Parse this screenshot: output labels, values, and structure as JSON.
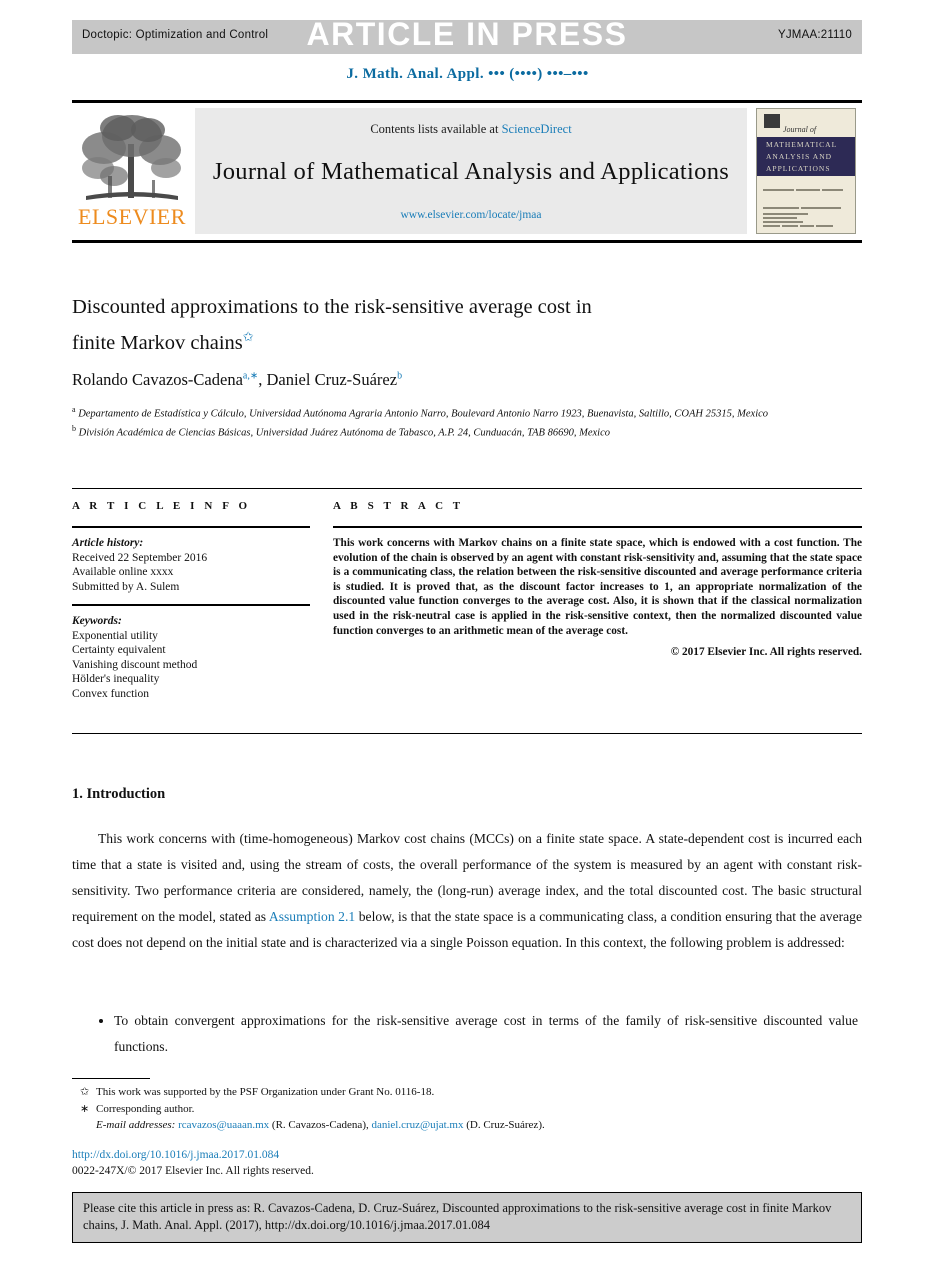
{
  "header": {
    "doctopic": "Doctopic: Optimization and Control",
    "article_in_press": "ARTICLE IN PRESS",
    "pii": "YJMAA:21110",
    "running_head": "J. Math. Anal. Appl. ••• (••••) •••–•••"
  },
  "masthead": {
    "contents_prefix": "Contents lists available at ",
    "sciencedirect": "ScienceDirect",
    "journal_name": "Journal of Mathematical Analysis and Applications",
    "journal_url": "www.elsevier.com/locate/jmaa",
    "publisher": "ELSEVIER",
    "cover": {
      "script": "Journal of",
      "line1": "MATHEMATICAL",
      "line2": "ANALYSIS AND",
      "line3": "APPLICATIONS"
    }
  },
  "article": {
    "title_line1": "Discounted approximations to the risk-sensitive average cost in",
    "title_line2": "finite Markov chains",
    "title_mark": "✩",
    "authors": "Rolando Cavazos-Cadena",
    "author1_sup": "a,∗",
    "authors2": ", Daniel Cruz-Suárez",
    "author2_sup": "b",
    "affiliation_a_sup": "a",
    "affiliation_a": "Departamento de Estadística y Cálculo, Universidad Autónoma Agraria Antonio Narro, Boulevard Antonio Narro 1923, Buenavista, Saltillo, COAH 25315, Mexico",
    "affiliation_b_sup": "b",
    "affiliation_b": "División Académica de Ciencias Básicas, Universidad Juárez Autónoma de Tabasco, A.P. 24, Cunduacán, TAB 86690, Mexico"
  },
  "info": {
    "heading": "A R T I C L E   I N F O",
    "history_label": "Article history:",
    "history": [
      "Received 22 September 2016",
      "Available online xxxx",
      "Submitted by A. Sulem"
    ],
    "keywords_label": "Keywords:",
    "keywords": [
      "Exponential utility",
      "Certainty equivalent",
      "Vanishing discount method",
      "Hölder's inequality",
      "Convex function"
    ]
  },
  "abstract": {
    "heading": "A B S T R A C T",
    "text": "This work concerns with Markov chains on a finite state space, which is endowed with a cost function. The evolution of the chain is observed by an agent with constant risk-sensitivity and, assuming that the state space is a communicating class, the relation between the risk-sensitive discounted and average performance criteria is studied. It is proved that, as the discount factor increases to 1, an appropriate normalization of the discounted value function converges to the average cost. Also, it is shown that if the classical normalization used in the risk-neutral case is applied in the risk-sensitive context, then the normalized discounted value function converges to an arithmetic mean of the average cost.",
    "copyright": "© 2017 Elsevier Inc. All rights reserved."
  },
  "body": {
    "section_title": "1. Introduction",
    "paragraph_part1": "This work concerns with (time-homogeneous) Markov cost chains (MCCs) on a finite state space. A state-dependent cost is incurred each time that a state is visited and, using the stream of costs, the overall performance of the system is measured by an agent with constant risk-sensitivity. Two performance criteria are considered, namely, the (long-run) average index, and the total discounted cost. The basic structural requirement on the model, stated as ",
    "assumption_link": "Assumption 2.1",
    "paragraph_part2": " below, is that the state space is a communicating class, a condition ensuring that the average cost does not depend on the initial state and is characterized via a single Poisson equation. In this context, the following problem is addressed:",
    "bullet1": "To obtain convergent approximations for the risk-sensitive average cost in terms of the family of risk-sensitive discounted value functions."
  },
  "footnotes": {
    "mark_star": "✩",
    "note_grant": "This work was supported by the PSF Organization under Grant No. 0116-18.",
    "mark_asterisk": "∗",
    "note_corresponding": "Corresponding author.",
    "email_label": "E-mail addresses:",
    "email1": "rcavazos@uaaan.mx",
    "email1_name": "(R. Cavazos-Cadena),",
    "email2": "daniel.cruz@ujat.mx",
    "email2_name": "(D. Cruz-Suárez)."
  },
  "doi": {
    "url": "http://dx.doi.org/10.1016/j.jmaa.2017.01.084",
    "issn_line": "0022-247X/© 2017 Elsevier Inc. All rights reserved."
  },
  "citation_box": {
    "text": "Please cite this article in press as: R. Cavazos-Cadena, D. Cruz-Suárez, Discounted approximations to the risk-sensitive average cost in finite Markov chains, J. Math. Anal. Appl. (2017), http://dx.doi.org/10.1016/j.jmaa.2017.01.084"
  }
}
